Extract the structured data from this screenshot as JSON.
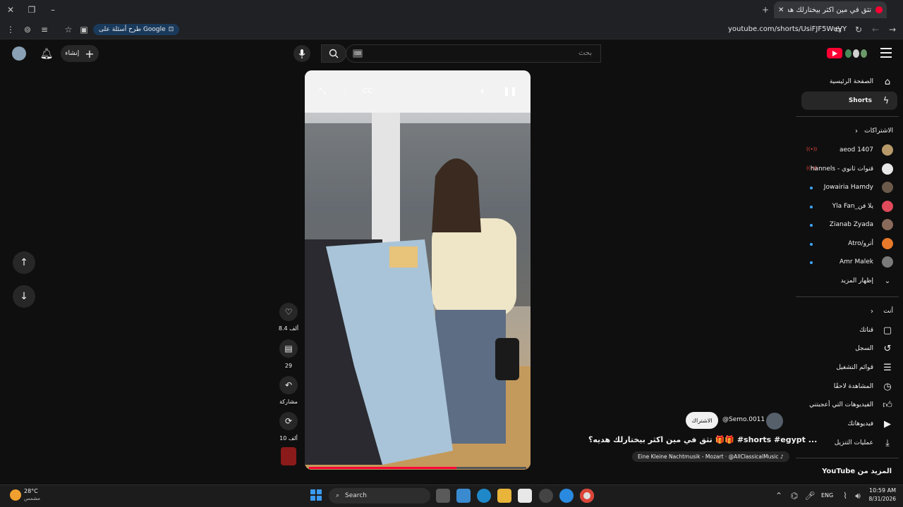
{
  "browser": {
    "tab_title": "تثق في مين اكثر بيختارلك هد...",
    "url": "youtube.com/shorts/UsiFJF5WuVY",
    "google_pill": "طرح أسئلة على Google"
  },
  "header": {
    "search_placeholder": "بحث",
    "create_label": "إنشاء"
  },
  "sidebar": {
    "home": "الصفحة الرئيسية",
    "shorts": "Shorts",
    "subscriptions_heading": "الاشتراكات",
    "subscriptions": [
      {
        "name": "aeod 1407",
        "live": true
      },
      {
        "name": "قنوات ثانوي - hannels...",
        "live": true
      },
      {
        "name": "Jowairia Hamdy",
        "live": false
      },
      {
        "name": "يلا فن_Yla Fan",
        "live": false
      },
      {
        "name": "Zianab Zyada",
        "live": false
      },
      {
        "name": "أترو/Atro",
        "live": false
      },
      {
        "name": "Amr Malek",
        "live": false
      }
    ],
    "show_more": "إظهار المزيد",
    "you_heading": "أنت",
    "you_items": [
      {
        "label": "قناتك",
        "icon": "channel-icon"
      },
      {
        "label": "السجل",
        "icon": "history-icon"
      },
      {
        "label": "قوائم التشغيل",
        "icon": "playlists-icon"
      },
      {
        "label": "المشاهدة لاحقًا",
        "icon": "watch-later-icon"
      },
      {
        "label": "الفيديوهات التي أعجبتني",
        "icon": "liked-icon"
      },
      {
        "label": "فيديوهاتك",
        "icon": "your-videos-icon"
      },
      {
        "label": "عمليات التنزيل",
        "icon": "downloads-icon"
      }
    ],
    "more_from_youtube": "المزيد من YouTube",
    "live_badge": "((•))"
  },
  "video": {
    "channel": "@Semo.0011",
    "subscribe": "الاشتراك",
    "title": "تثق في مين اكثر بيختارلك هديه؟ 🎁🎁 #shorts #egypt ...",
    "music": "Eine Kleine Nachtmusik - Mozart · @AllClassicalMusic ♪",
    "likes": "8.4 ألف",
    "comments": "29",
    "share": "مشاركة",
    "remix": "10 ألف",
    "progress": 0.68
  },
  "taskbar": {
    "weather_temp": "28°C",
    "weather_desc": "مشمس",
    "search": "Search",
    "lang": "ENG",
    "time": "10:59 AM",
    "date": "8/31/2026"
  }
}
